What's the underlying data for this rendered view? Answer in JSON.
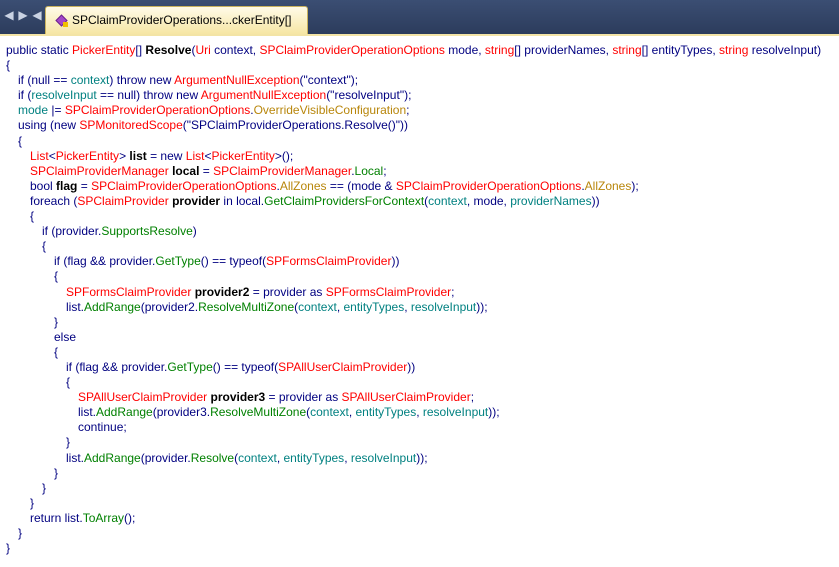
{
  "tab": {
    "title": "SPClaimProviderOperations...ckerEntity[]"
  },
  "colors": {
    "default": "#000080",
    "keyword": "#000080",
    "type": "#ff0000",
    "member": "#008000",
    "parameter": "#008080",
    "enum": "#b8860b",
    "string": "#000080",
    "bold": "#000000"
  },
  "code": {
    "lines": [
      {
        "indent": 0,
        "tokens": [
          {
            "t": "public static ",
            "c": "keyword"
          },
          {
            "t": "PickerEntity",
            "c": "type"
          },
          {
            "t": "[] ",
            "c": "keyword"
          },
          {
            "t": "Resolve",
            "c": "bold",
            "b": true
          },
          {
            "t": "(",
            "c": "default"
          },
          {
            "t": "Uri",
            "c": "type"
          },
          {
            "t": " context, ",
            "c": "default"
          },
          {
            "t": "SPClaimProviderOperationOptions",
            "c": "type"
          },
          {
            "t": " mode, ",
            "c": "default"
          },
          {
            "t": "string",
            "c": "type"
          },
          {
            "t": "[] providerNames, ",
            "c": "default"
          },
          {
            "t": "string",
            "c": "type"
          },
          {
            "t": "[] entityTypes, ",
            "c": "default"
          },
          {
            "t": "string",
            "c": "type"
          },
          {
            "t": " resolveInput)",
            "c": "default"
          }
        ]
      },
      {
        "indent": 0,
        "tokens": [
          {
            "t": "{",
            "c": "default"
          }
        ]
      },
      {
        "indent": 1,
        "tokens": [
          {
            "t": "if (null == ",
            "c": "keyword"
          },
          {
            "t": "context",
            "c": "parameter"
          },
          {
            "t": ") throw new ",
            "c": "keyword"
          },
          {
            "t": "ArgumentNullException",
            "c": "type"
          },
          {
            "t": "(\"context\");",
            "c": "string"
          }
        ]
      },
      {
        "indent": 1,
        "tokens": [
          {
            "t": "if (",
            "c": "keyword"
          },
          {
            "t": "resolveInput",
            "c": "parameter"
          },
          {
            "t": " == null) throw new ",
            "c": "keyword"
          },
          {
            "t": "ArgumentNullException",
            "c": "type"
          },
          {
            "t": "(\"resolveInput\");",
            "c": "string"
          }
        ]
      },
      {
        "indent": 1,
        "tokens": [
          {
            "t": "mode",
            "c": "parameter"
          },
          {
            "t": " |= ",
            "c": "default"
          },
          {
            "t": "SPClaimProviderOperationOptions",
            "c": "type"
          },
          {
            "t": ".",
            "c": "default"
          },
          {
            "t": "OverrideVisibleConfiguration",
            "c": "enum"
          },
          {
            "t": ";",
            "c": "default"
          }
        ]
      },
      {
        "indent": 1,
        "tokens": [
          {
            "t": "using (new ",
            "c": "keyword"
          },
          {
            "t": "SPMonitoredScope",
            "c": "type"
          },
          {
            "t": "(\"SPClaimProviderOperations.Resolve()\"))",
            "c": "string"
          }
        ]
      },
      {
        "indent": 1,
        "tokens": [
          {
            "t": "{",
            "c": "default"
          }
        ]
      },
      {
        "indent": 2,
        "tokens": [
          {
            "t": "List",
            "c": "type"
          },
          {
            "t": "<",
            "c": "default"
          },
          {
            "t": "PickerEntity",
            "c": "type"
          },
          {
            "t": "> ",
            "c": "default"
          },
          {
            "t": "list",
            "c": "bold",
            "b": true
          },
          {
            "t": " = new ",
            "c": "keyword"
          },
          {
            "t": "List",
            "c": "type"
          },
          {
            "t": "<",
            "c": "default"
          },
          {
            "t": "PickerEntity",
            "c": "type"
          },
          {
            "t": ">();",
            "c": "default"
          }
        ]
      },
      {
        "indent": 2,
        "tokens": [
          {
            "t": "SPClaimProviderManager",
            "c": "type"
          },
          {
            "t": " ",
            "c": "default"
          },
          {
            "t": "local",
            "c": "bold",
            "b": true
          },
          {
            "t": " = ",
            "c": "default"
          },
          {
            "t": "SPClaimProviderManager",
            "c": "type"
          },
          {
            "t": ".",
            "c": "default"
          },
          {
            "t": "Local",
            "c": "member"
          },
          {
            "t": ";",
            "c": "default"
          }
        ]
      },
      {
        "indent": 2,
        "tokens": [
          {
            "t": "bool ",
            "c": "keyword"
          },
          {
            "t": "flag",
            "c": "bold",
            "b": true
          },
          {
            "t": " = ",
            "c": "default"
          },
          {
            "t": "SPClaimProviderOperationOptions",
            "c": "type"
          },
          {
            "t": ".",
            "c": "default"
          },
          {
            "t": "AllZones",
            "c": "enum"
          },
          {
            "t": " == (mode & ",
            "c": "default"
          },
          {
            "t": "SPClaimProviderOperationOptions",
            "c": "type"
          },
          {
            "t": ".",
            "c": "default"
          },
          {
            "t": "AllZones",
            "c": "enum"
          },
          {
            "t": ");",
            "c": "default"
          }
        ]
      },
      {
        "indent": 2,
        "tokens": [
          {
            "t": "foreach (",
            "c": "keyword"
          },
          {
            "t": "SPClaimProvider",
            "c": "type"
          },
          {
            "t": " ",
            "c": "default"
          },
          {
            "t": "provider",
            "c": "bold",
            "b": true
          },
          {
            "t": " in local.",
            "c": "default"
          },
          {
            "t": "GetClaimProvidersForContext",
            "c": "member"
          },
          {
            "t": "(",
            "c": "default"
          },
          {
            "t": "context",
            "c": "parameter"
          },
          {
            "t": ", mode, ",
            "c": "default"
          },
          {
            "t": "providerNames",
            "c": "parameter"
          },
          {
            "t": "))",
            "c": "default"
          }
        ]
      },
      {
        "indent": 2,
        "tokens": [
          {
            "t": "{",
            "c": "default"
          }
        ]
      },
      {
        "indent": 3,
        "tokens": [
          {
            "t": "if (provider.",
            "c": "keyword"
          },
          {
            "t": "SupportsResolve",
            "c": "member"
          },
          {
            "t": ")",
            "c": "default"
          }
        ]
      },
      {
        "indent": 3,
        "tokens": [
          {
            "t": "{",
            "c": "default"
          }
        ]
      },
      {
        "indent": 4,
        "tokens": [
          {
            "t": "if (flag && provider.",
            "c": "keyword"
          },
          {
            "t": "GetType",
            "c": "member"
          },
          {
            "t": "() == typeof(",
            "c": "default"
          },
          {
            "t": "SPFormsClaimProvider",
            "c": "type"
          },
          {
            "t": "))",
            "c": "default"
          }
        ]
      },
      {
        "indent": 4,
        "tokens": [
          {
            "t": "{",
            "c": "default"
          }
        ]
      },
      {
        "indent": 5,
        "tokens": [
          {
            "t": "SPFormsClaimProvider",
            "c": "type"
          },
          {
            "t": " ",
            "c": "default"
          },
          {
            "t": "provider2",
            "c": "bold",
            "b": true
          },
          {
            "t": " = provider as ",
            "c": "default"
          },
          {
            "t": "SPFormsClaimProvider",
            "c": "type"
          },
          {
            "t": ";",
            "c": "default"
          }
        ]
      },
      {
        "indent": 5,
        "tokens": [
          {
            "t": "list.",
            "c": "default"
          },
          {
            "t": "AddRange",
            "c": "member"
          },
          {
            "t": "(provider2.",
            "c": "default"
          },
          {
            "t": "ResolveMultiZone",
            "c": "member"
          },
          {
            "t": "(",
            "c": "default"
          },
          {
            "t": "context",
            "c": "parameter"
          },
          {
            "t": ", ",
            "c": "default"
          },
          {
            "t": "entityTypes",
            "c": "parameter"
          },
          {
            "t": ", ",
            "c": "default"
          },
          {
            "t": "resolveInput",
            "c": "parameter"
          },
          {
            "t": "));",
            "c": "default"
          }
        ]
      },
      {
        "indent": 4,
        "tokens": [
          {
            "t": "}",
            "c": "default"
          }
        ]
      },
      {
        "indent": 4,
        "tokens": [
          {
            "t": "else",
            "c": "keyword"
          }
        ]
      },
      {
        "indent": 4,
        "tokens": [
          {
            "t": "{",
            "c": "default"
          }
        ]
      },
      {
        "indent": 5,
        "tokens": [
          {
            "t": "if (flag && provider.",
            "c": "keyword"
          },
          {
            "t": "GetType",
            "c": "member"
          },
          {
            "t": "() == typeof(",
            "c": "default"
          },
          {
            "t": "SPAllUserClaimProvider",
            "c": "type"
          },
          {
            "t": "))",
            "c": "default"
          }
        ]
      },
      {
        "indent": 5,
        "tokens": [
          {
            "t": "{",
            "c": "default"
          }
        ]
      },
      {
        "indent": 6,
        "tokens": [
          {
            "t": "SPAllUserClaimProvider",
            "c": "type"
          },
          {
            "t": " ",
            "c": "default"
          },
          {
            "t": "provider3",
            "c": "bold",
            "b": true
          },
          {
            "t": " = provider as ",
            "c": "default"
          },
          {
            "t": "SPAllUserClaimProvider",
            "c": "type"
          },
          {
            "t": ";",
            "c": "default"
          }
        ]
      },
      {
        "indent": 6,
        "tokens": [
          {
            "t": "list.",
            "c": "default"
          },
          {
            "t": "AddRange",
            "c": "member"
          },
          {
            "t": "(provider3.",
            "c": "default"
          },
          {
            "t": "ResolveMultiZone",
            "c": "member"
          },
          {
            "t": "(",
            "c": "default"
          },
          {
            "t": "context",
            "c": "parameter"
          },
          {
            "t": ", ",
            "c": "default"
          },
          {
            "t": "entityTypes",
            "c": "parameter"
          },
          {
            "t": ", ",
            "c": "default"
          },
          {
            "t": "resolveInput",
            "c": "parameter"
          },
          {
            "t": "));",
            "c": "default"
          }
        ]
      },
      {
        "indent": 6,
        "tokens": [
          {
            "t": "continue;",
            "c": "keyword"
          }
        ]
      },
      {
        "indent": 5,
        "tokens": [
          {
            "t": "}",
            "c": "default"
          }
        ]
      },
      {
        "indent": 5,
        "tokens": [
          {
            "t": "list.",
            "c": "default"
          },
          {
            "t": "AddRange",
            "c": "member"
          },
          {
            "t": "(provider.",
            "c": "default"
          },
          {
            "t": "Resolve",
            "c": "member"
          },
          {
            "t": "(",
            "c": "default"
          },
          {
            "t": "context",
            "c": "parameter"
          },
          {
            "t": ", ",
            "c": "default"
          },
          {
            "t": "entityTypes",
            "c": "parameter"
          },
          {
            "t": ", ",
            "c": "default"
          },
          {
            "t": "resolveInput",
            "c": "parameter"
          },
          {
            "t": "));",
            "c": "default"
          }
        ]
      },
      {
        "indent": 4,
        "tokens": [
          {
            "t": "}",
            "c": "default"
          }
        ]
      },
      {
        "indent": 3,
        "tokens": [
          {
            "t": "}",
            "c": "default"
          }
        ]
      },
      {
        "indent": 2,
        "tokens": [
          {
            "t": "}",
            "c": "default"
          }
        ]
      },
      {
        "indent": 2,
        "tokens": [
          {
            "t": "return list.",
            "c": "keyword"
          },
          {
            "t": "ToArray",
            "c": "member"
          },
          {
            "t": "();",
            "c": "default"
          }
        ]
      },
      {
        "indent": 1,
        "tokens": [
          {
            "t": "}",
            "c": "default"
          }
        ]
      },
      {
        "indent": 0,
        "tokens": [
          {
            "t": "}",
            "c": "default"
          }
        ]
      }
    ]
  }
}
